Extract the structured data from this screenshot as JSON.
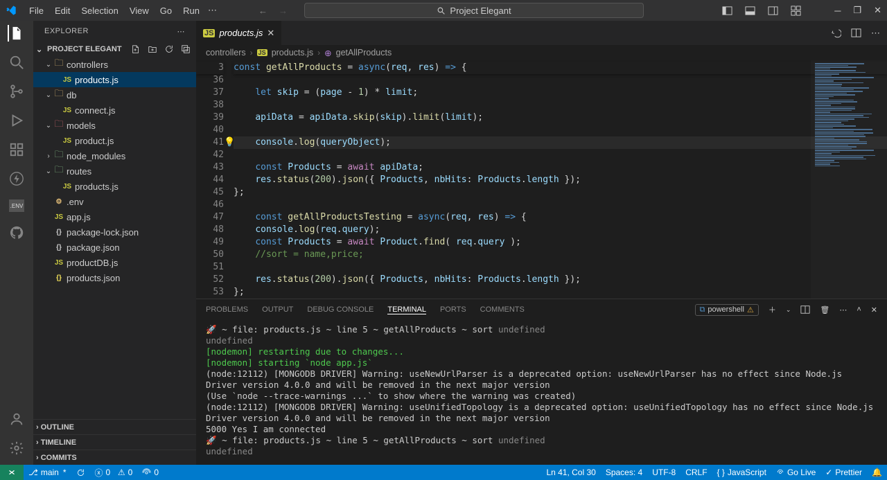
{
  "menubar": {
    "items": [
      "File",
      "Edit",
      "Selection",
      "View",
      "Go",
      "Run"
    ],
    "search_label": "Project Elegant"
  },
  "sidebar": {
    "title": "EXPLORER",
    "project": "PROJECT ELEGANT",
    "tree": [
      {
        "kind": "folder",
        "open": true,
        "depth": 0,
        "label": "controllers",
        "cls": "fc-yellow"
      },
      {
        "kind": "file",
        "depth": 1,
        "label": "products.js",
        "cls": "fc-js",
        "selected": true
      },
      {
        "kind": "folder",
        "open": true,
        "depth": 0,
        "label": "db",
        "cls": "fc-yellow"
      },
      {
        "kind": "file",
        "depth": 1,
        "label": "connect.js",
        "cls": "fc-js"
      },
      {
        "kind": "folder",
        "open": true,
        "depth": 0,
        "label": "models",
        "cls": "fc-red"
      },
      {
        "kind": "file",
        "depth": 1,
        "label": "product.js",
        "cls": "fc-js"
      },
      {
        "kind": "folder",
        "open": false,
        "depth": 0,
        "label": "node_modules",
        "cls": "fc-green"
      },
      {
        "kind": "folder",
        "open": true,
        "depth": 0,
        "label": "routes",
        "cls": "fc-green"
      },
      {
        "kind": "file",
        "depth": 1,
        "label": "products.js",
        "cls": "fc-js"
      },
      {
        "kind": "file",
        "depth": 0,
        "label": ".env",
        "cls": "fc-yellow"
      },
      {
        "kind": "file",
        "depth": 0,
        "label": "app.js",
        "cls": "fc-js"
      },
      {
        "kind": "file",
        "depth": 0,
        "label": "package-lock.json",
        "cls": "fc-grey"
      },
      {
        "kind": "file",
        "depth": 0,
        "label": "package.json",
        "cls": "fc-grey"
      },
      {
        "kind": "file",
        "depth": 0,
        "label": "productDB.js",
        "cls": "fc-js"
      },
      {
        "kind": "file",
        "depth": 0,
        "label": "products.json",
        "cls": "fc-json"
      }
    ],
    "sections": [
      "OUTLINE",
      "TIMELINE",
      "COMMITS"
    ]
  },
  "tab": {
    "label": "products.js"
  },
  "breadcrumbs": {
    "parts": [
      "controllers",
      "products.js",
      "getAllProducts"
    ]
  },
  "code": {
    "sticky": {
      "num": 3,
      "html": "<span class='kw'>const</span> <span class='fn'>getAllProducts</span> <span class='pun'>=</span> <span class='kw'>async</span><span class='pun'>(</span><span class='var'>req</span><span class='pun'>, </span><span class='var'>res</span><span class='pun'>) </span><span class='kw'>=&gt;</span> <span class='pun'>{</span>"
    },
    "lines": [
      {
        "num": 36,
        "html": ""
      },
      {
        "num": 37,
        "html": "    <span class='kw'>let</span> <span class='var'>skip</span> <span class='pun'>= (</span><span class='var'>page</span> <span class='pun'>-</span> <span class='num'>1</span><span class='pun'>) *</span> <span class='var'>limit</span><span class='pun'>;</span>"
      },
      {
        "num": 38,
        "html": ""
      },
      {
        "num": 39,
        "html": "    <span class='var'>apiData</span> <span class='pun'>=</span> <span class='var'>apiData</span><span class='pun'>.</span><span class='fn'>skip</span><span class='pun'>(</span><span class='var'>skip</span><span class='pun'>).</span><span class='fn'>limit</span><span class='pun'>(</span><span class='var'>limit</span><span class='pun'>);</span>"
      },
      {
        "num": 40,
        "html": ""
      },
      {
        "num": 41,
        "html": "    <span class='var'>console</span><span class='pun'>.</span><span class='fn'>log</span><span class='pun'>(</span><span class='var'>queryObject</span><span class='pun'>);</span>",
        "current": true
      },
      {
        "num": 42,
        "html": ""
      },
      {
        "num": 43,
        "html": "    <span class='kw'>const</span> <span class='var'>Products</span> <span class='pun'>=</span> <span class='kw2'>await</span> <span class='var'>apiData</span><span class='pun'>;</span>"
      },
      {
        "num": 44,
        "html": "    <span class='var'>res</span><span class='pun'>.</span><span class='fn'>status</span><span class='pun'>(</span><span class='num'>200</span><span class='pun'>).</span><span class='fn'>json</span><span class='pun'>({ </span><span class='var'>Products</span><span class='pun'>, </span><span class='var'>nbHits</span><span class='pun'>: </span><span class='var'>Products</span><span class='pun'>.</span><span class='var'>length</span><span class='pun'> });</span>"
      },
      {
        "num": 45,
        "html": "<span class='pun'>};</span>"
      },
      {
        "num": 46,
        "html": ""
      },
      {
        "num": 47,
        "html": "    <span class='kw'>const</span> <span class='fn'>getAllProductsTesting</span> <span class='pun'>=</span> <span class='kw'>async</span><span class='pun'>(</span><span class='var'>req</span><span class='pun'>, </span><span class='var'>res</span><span class='pun'>) </span><span class='kw'>=&gt;</span> <span class='pun'>{</span>"
      },
      {
        "num": 48,
        "html": "    <span class='var'>console</span><span class='pun'>.</span><span class='fn'>log</span><span class='pun'>(</span><span class='var'>req</span><span class='pun'>.</span><span class='var'>query</span><span class='pun'>);</span>"
      },
      {
        "num": 49,
        "html": "    <span class='kw'>const</span> <span class='var'>Products</span> <span class='pun'>=</span> <span class='kw2'>await</span> <span class='var'>Product</span><span class='pun'>.</span><span class='fn'>find</span><span class='pun'>( </span><span class='var'>req</span><span class='pun'>.</span><span class='var'>query</span><span class='pun'> );</span>"
      },
      {
        "num": 50,
        "html": "    <span class='com'>//sort = name,price;</span>"
      },
      {
        "num": 51,
        "html": ""
      },
      {
        "num": 52,
        "html": "    <span class='var'>res</span><span class='pun'>.</span><span class='fn'>status</span><span class='pun'>(</span><span class='num'>200</span><span class='pun'>).</span><span class='fn'>json</span><span class='pun'>({ </span><span class='var'>Products</span><span class='pun'>, </span><span class='var'>nbHits</span><span class='pun'>: </span><span class='var'>Products</span><span class='pun'>.</span><span class='var'>length</span><span class='pun'> });</span>"
      },
      {
        "num": 53,
        "html": "<span class='pun'>};</span>"
      }
    ]
  },
  "panel": {
    "tabs": [
      "PROBLEMS",
      "OUTPUT",
      "DEBUG CONSOLE",
      "TERMINAL",
      "PORTS",
      "COMMENTS"
    ],
    "active_tab": "TERMINAL",
    "shell": "powershell",
    "lines": [
      {
        "html": "🚀 ~ file: products.js ~ line 5 ~ getAllProducts ~ sort <span class='dim'>undefined</span>"
      },
      {
        "html": "<span class='dim'>undefined</span>"
      },
      {
        "html": "<span class='green'>[nodemon] restarting due to changes...</span>"
      },
      {
        "html": "<span class='green'>[nodemon] starting </span><span class='green'>`node app.js`</span>"
      },
      {
        "html": "(node:12112) [MONGODB DRIVER] Warning: useNewUrlParser is a deprecated option: useNewUrlParser has no effect since Node.js Driver version 4.0.0 and will be removed in the next major version"
      },
      {
        "html": "(Use `node --trace-warnings ...` to show where the warning was created)"
      },
      {
        "html": "(node:12112) [MONGODB DRIVER] Warning: useUnifiedTopology is a deprecated option: useUnifiedTopology has no effect since Node.js Driver version 4.0.0 and will be removed in the next major version"
      },
      {
        "html": "5000 Yes I am connected"
      },
      {
        "html": "🚀 ~ file: products.js ~ line 5 ~ getAllProducts ~ sort <span class='dim'>undefined</span>"
      },
      {
        "html": "<span class='dim'>undefined</span>"
      }
    ]
  },
  "status": {
    "branch": "main",
    "sync": "",
    "errors": "0",
    "warnings": "0",
    "ports": "0",
    "ln": "Ln 41, Col 30",
    "spaces": "Spaces: 4",
    "enc": "UTF-8",
    "eol": "CRLF",
    "lang": "JavaScript",
    "golive": "Go Live",
    "prettier": "Prettier"
  }
}
